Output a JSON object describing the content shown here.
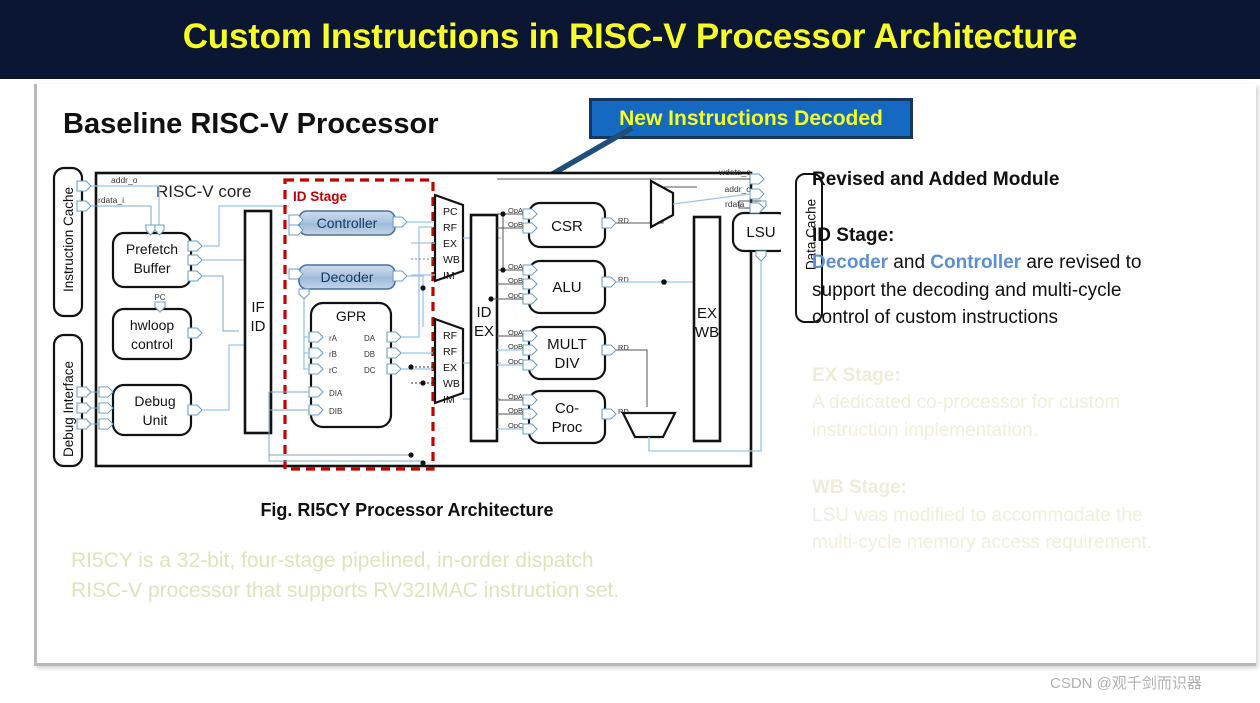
{
  "title": "Custom Instructions in RISC-V Processor Architecture",
  "section_heading": "Baseline RISC-V Processor",
  "callout": {
    "label": "New Instructions Decoded",
    "box_color": "#1569c0",
    "border_color": "#15365e",
    "text_color": "#f7ff26",
    "arrow_color": "#1f4e79"
  },
  "colors": {
    "title_bar": "#0b1632",
    "title_text": "#f7ff26",
    "accent_blue": "#5b8fd1",
    "id_stage_red": "#c00000",
    "module_fill": "#aac6e0",
    "wire_blue": "#9dc3e6",
    "faded_cream": "#efecd9",
    "faded_olive": "#dfe3bd"
  },
  "right_panel": {
    "heading": "Revised and Added Module",
    "sections": [
      {
        "title": "ID Stage:",
        "faded": false,
        "line1_a": "Decoder",
        "line1_b": " and ",
        "line1_c": "Controller",
        "line1_d": " are revised to",
        "line2": "support the decoding and multi-cycle",
        "line3": "control of custom instructions"
      },
      {
        "title": "EX Stage:",
        "faded": true,
        "line1": "A dedicated co-processor for custom",
        "line2": "instruction implementation."
      },
      {
        "title": "WB Stage:",
        "faded": true,
        "line1": "LSU was modified to accommodate the",
        "line2": "multi-cycle memory access requirement."
      }
    ]
  },
  "figure_caption": "Fig. RI5CY Processor  Architecture",
  "summary": {
    "line1": "RI5CY is a 32-bit, four-stage pipelined, in-order dispatch",
    "line2": "RISC-V processor that supports RV32IMAC instruction set."
  },
  "watermark": "CSDN @观千剑而识器",
  "diagram": {
    "core_label": "RISC-V core",
    "id_stage_label": "ID Stage",
    "left_ports": [
      {
        "name": "instruction-cache",
        "label": "Instruction Cache"
      },
      {
        "name": "debug-interface",
        "label": "Debug Interface"
      }
    ],
    "right_ports": [
      {
        "name": "data-cache",
        "label": "Data Cache"
      }
    ],
    "signal_labels": {
      "addr_o_left": "addr_o",
      "rdata_i_left": "rdata_i",
      "wdata_o_right": "wdata_o",
      "addr_o_right": "addr_o",
      "rdata_i_right": "rdata_i"
    },
    "if_blocks": [
      {
        "name": "prefetch-buffer",
        "line1": "Prefetch",
        "line2": "Buffer"
      },
      {
        "name": "hwloop-control",
        "line1": "hwloop",
        "line2": "control",
        "port": "PC"
      },
      {
        "name": "debug-unit",
        "line1": "Debug",
        "line2": "Unit"
      }
    ],
    "pipeline_registers": [
      {
        "name": "if-id-register",
        "line1": "IF",
        "line2": "ID"
      },
      {
        "name": "id-ex-register",
        "line1": "ID",
        "line2": "EX"
      },
      {
        "name": "ex-wb-register",
        "line1": "EX",
        "line2": "WB"
      }
    ],
    "id_modules": [
      {
        "name": "controller",
        "label": "Controller"
      },
      {
        "name": "decoder",
        "label": "Decoder"
      }
    ],
    "gpr": {
      "label": "GPR",
      "inputs": [
        "rA",
        "rB",
        "rC",
        "DIA",
        "DIB"
      ],
      "outputs": [
        "DA",
        "DB",
        "DC"
      ]
    },
    "mux_top_labels": [
      "PC",
      "RF",
      "EX",
      "WB",
      "IM"
    ],
    "mux_bottom_labels": [
      "RF",
      "RF",
      "EX",
      "WB",
      "IM"
    ],
    "ex_units": [
      {
        "name": "csr-unit",
        "line1": "CSR",
        "line2": "",
        "inputs": [
          "OpA",
          "OpB"
        ],
        "output": "RD"
      },
      {
        "name": "alu-unit",
        "line1": "ALU",
        "line2": "",
        "inputs": [
          "OpA",
          "OpB",
          "OpC"
        ],
        "output": "RD"
      },
      {
        "name": "mult-div-unit",
        "line1": "MULT",
        "line2": "DIV",
        "inputs": [
          "OpA",
          "OpB",
          "OpC"
        ],
        "output": "RD"
      },
      {
        "name": "co-proc-unit",
        "line1": "Co-",
        "line2": "Proc",
        "inputs": [
          "OpA",
          "OpB",
          "OpC"
        ],
        "output": "RD"
      }
    ],
    "lsu": {
      "name": "lsu-unit",
      "label": "LSU"
    }
  }
}
